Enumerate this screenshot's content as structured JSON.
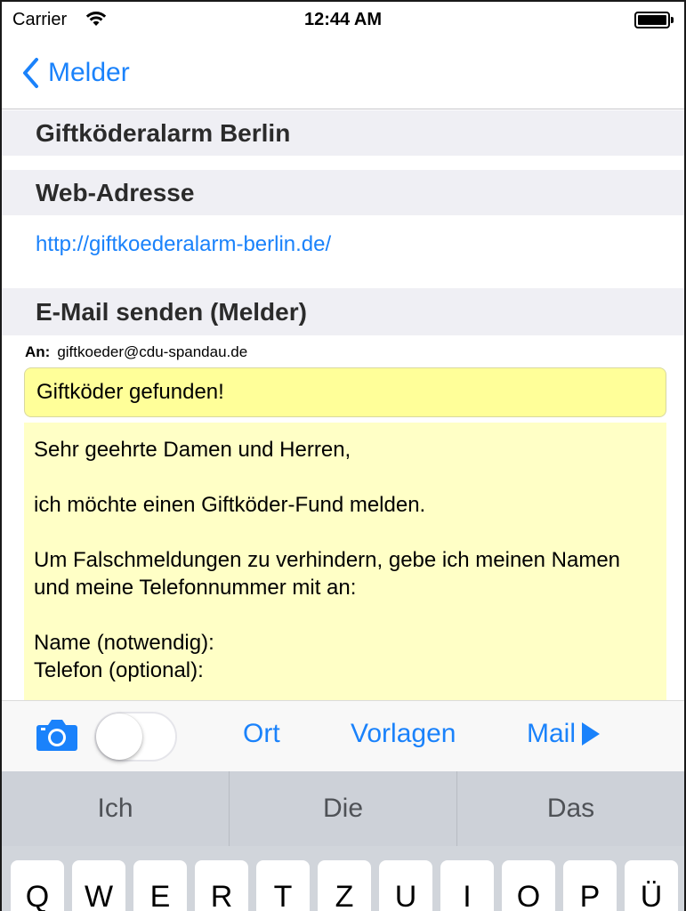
{
  "status_bar": {
    "carrier": "Carrier",
    "time": "12:44 AM"
  },
  "nav": {
    "back_label": "Melder"
  },
  "sections": {
    "title": "Giftköderalarm Berlin",
    "web_header": "Web-Adresse",
    "web_url": "http://giftkoederalarm-berlin.de/",
    "email_header": "E-Mail senden (Melder)"
  },
  "email": {
    "to_label": "An:",
    "to_address": "giftkoeder@cdu-spandau.de",
    "subject": "Giftköder gefunden!",
    "body": "Sehr geehrte Damen und Herren,\n\nich möchte einen Giftköder-Fund melden.\n\nUm Falschmeldungen zu verhindern, gebe ich meinen Namen und meine Telefonnummer mit an:\n\nName (notwendig):\nTelefon (optional):"
  },
  "toolbar": {
    "camera_icon": "camera-icon",
    "toggle_on": false,
    "ort_label": "Ort",
    "vorlagen_label": "Vorlagen",
    "mail_label": "Mail"
  },
  "keyboard": {
    "suggestions": [
      "Ich",
      "Die",
      "Das"
    ],
    "keys": [
      "Q",
      "W",
      "E",
      "R",
      "T",
      "Z",
      "U",
      "I",
      "O",
      "P",
      "Ü"
    ]
  },
  "colors": {
    "accent": "#1a82fb",
    "subject_bg": "#ffff99",
    "body_bg": "#ffffc6",
    "section_bg": "#efeff4"
  }
}
